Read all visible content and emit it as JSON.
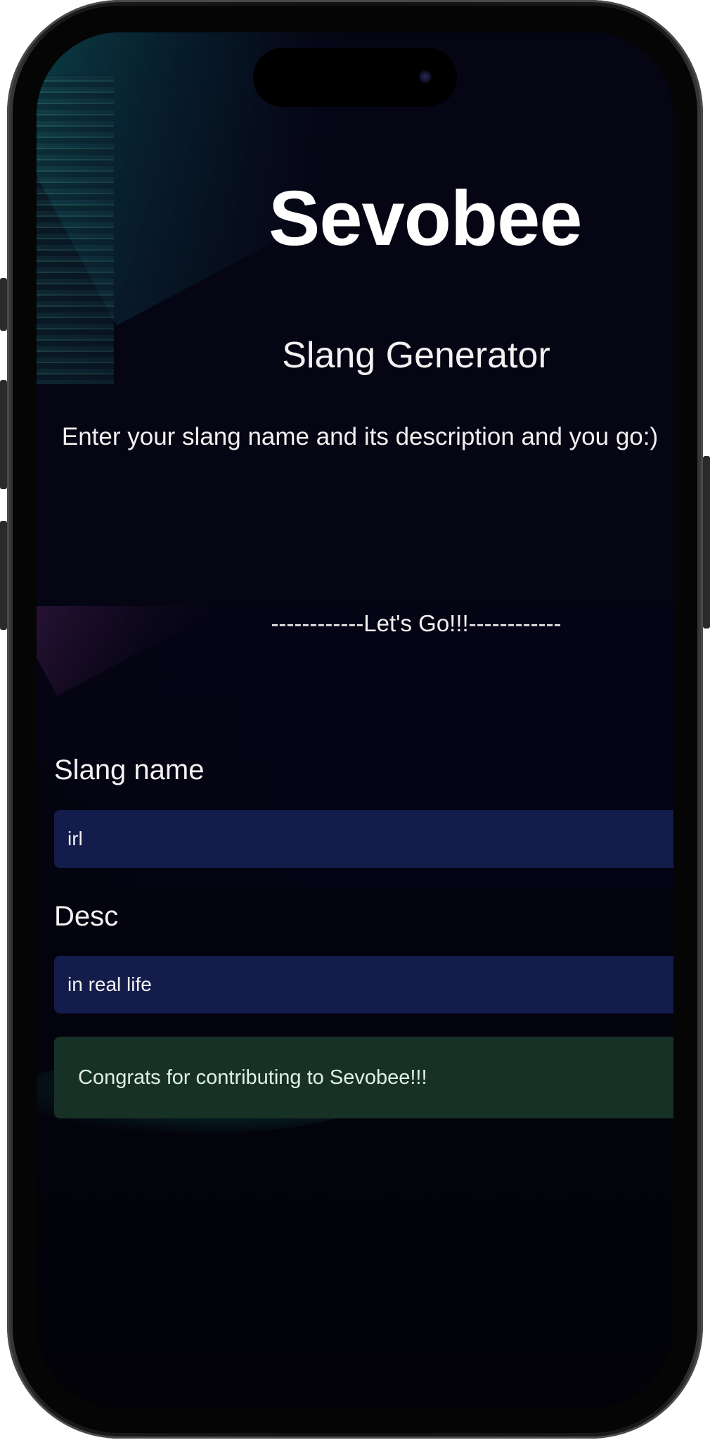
{
  "app": {
    "brand": "Sevobee",
    "subtitle": "Slang Generator",
    "instructions": "Enter your slang name and its description and you go:)",
    "divider": "------------Let's Go!!!------------"
  },
  "form": {
    "slang_name": {
      "label": "Slang name",
      "value": "irl"
    },
    "desc": {
      "label": "Desc",
      "value": "in real life"
    }
  },
  "alert": {
    "message": "Congrats for contributing to Sevobee!!!",
    "status": "success"
  },
  "colors": {
    "input_bg": "#141c4b",
    "alert_bg": "#173127",
    "page_bg": "#050514"
  }
}
